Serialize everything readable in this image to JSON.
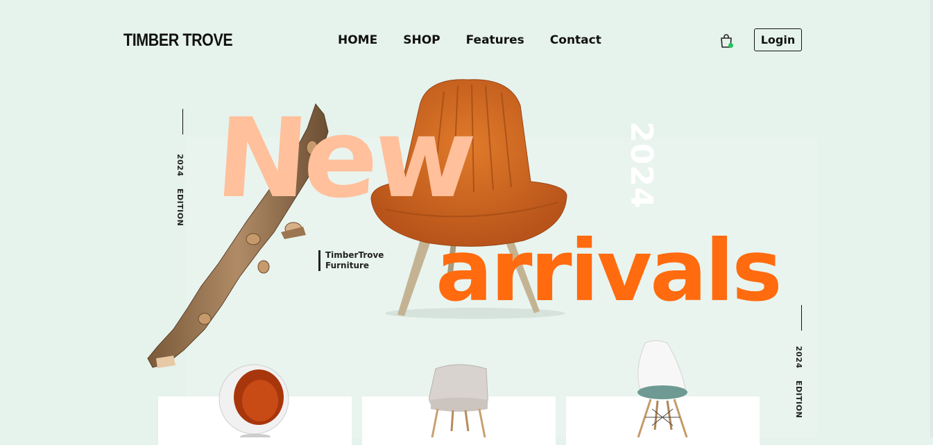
{
  "header": {
    "logo": "TIMBER TROVE",
    "nav": [
      "HOME",
      "SHOP",
      "Features",
      "Contact"
    ],
    "login_label": "Login",
    "cart_icon": "shopping-bag-icon",
    "cart_dot_color": "#21c45a"
  },
  "hero": {
    "new_word": "New",
    "arrivals_word": "arrivals",
    "year_big": "2024",
    "edition_left": "2024    EDITION",
    "edition_right": "2024    EDITION",
    "brand_line1": "TimberTrove",
    "brand_line2": "Furniture",
    "colors": {
      "new": "#ffc09b",
      "arrivals": "#ff6b0e",
      "background": "#e6f2ec"
    }
  },
  "products": [
    {
      "name": "ball-chair"
    },
    {
      "name": "armchair"
    },
    {
      "name": "eames-chair"
    }
  ]
}
